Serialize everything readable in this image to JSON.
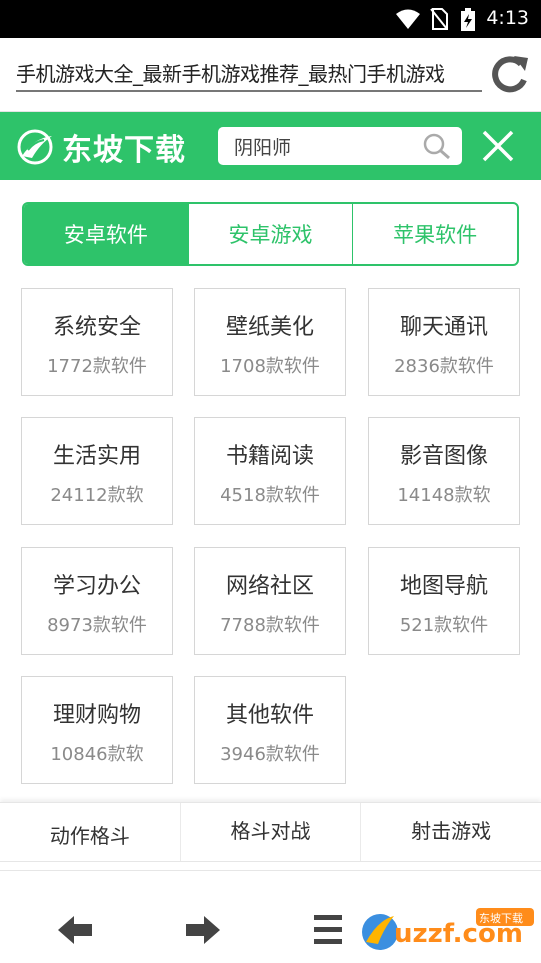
{
  "status_bar": {
    "time": "4:13"
  },
  "browser": {
    "url_title": "手机游戏大全_最新手机游戏推荐_最热门手机游戏"
  },
  "header": {
    "brand": "东坡下载",
    "search_value": "阴阳师"
  },
  "tabs": [
    {
      "label": "安卓软件",
      "active": true
    },
    {
      "label": "安卓游戏",
      "active": false
    },
    {
      "label": "苹果软件",
      "active": false
    }
  ],
  "categories": [
    {
      "name": "系统安全",
      "count": "1772款软件"
    },
    {
      "name": "壁纸美化",
      "count": "1708款软件"
    },
    {
      "name": "聊天通讯",
      "count": "2836款软件"
    },
    {
      "name": "生活实用",
      "count": "24112款软"
    },
    {
      "name": "书籍阅读",
      "count": "4518款软件"
    },
    {
      "name": "影音图像",
      "count": "14148款软"
    },
    {
      "name": "学习办公",
      "count": "8973款软件"
    },
    {
      "name": "网络社区",
      "count": "7788款软件"
    },
    {
      "name": "地图导航",
      "count": "521款软件"
    },
    {
      "name": "理财购物",
      "count": "10846款软"
    },
    {
      "name": "其他软件",
      "count": "3946款软件"
    }
  ],
  "game_strip": [
    "动作格斗",
    "格斗对战",
    "射击游戏"
  ],
  "watermark": {
    "badge": "东坡下载",
    "domain": "uzzf.com"
  },
  "colors": {
    "accent": "#2ec36a"
  }
}
